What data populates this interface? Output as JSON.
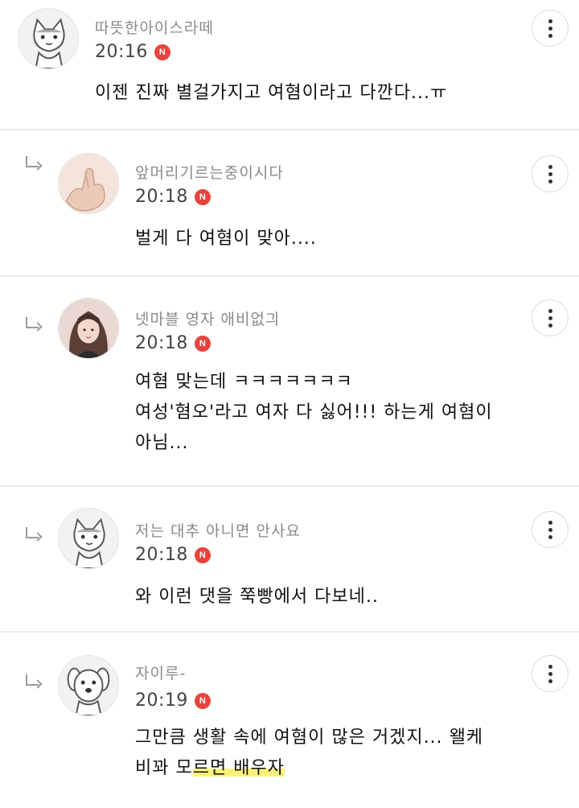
{
  "comments": [
    {
      "nickname": "따뜻한아이스라떼",
      "time": "20:16",
      "badge": "N",
      "lines": [
        "이젠 진짜 별걸가지고 여혐이라고 다깐다...ㅠ"
      ],
      "avatar": "cat-sketch-avatar",
      "is_reply": false
    },
    {
      "nickname": "앞머리기르는중이시다",
      "time": "20:18",
      "badge": "N",
      "lines": [
        "벌게 다 여혐이 맞아...."
      ],
      "avatar": "hand-photo-avatar",
      "is_reply": true
    },
    {
      "nickname": "넷마블 영자 애비없긔",
      "time": "20:18",
      "badge": "N",
      "lines": [
        "여혐 맞는데 ㅋㅋㅋㅋㅋㅋㅋ",
        "여성'혐오'라고 여자 다 싫어!!! 하는게 여혐이",
        "아님..."
      ],
      "avatar": "girl-photo-avatar",
      "is_reply": true
    },
    {
      "nickname": "저는 대추 아니면 안사요",
      "time": "20:18",
      "badge": "N",
      "lines": [
        "와 이런 댓을 쭉빵에서 다보네.."
      ],
      "avatar": "cat-sketch-avatar",
      "is_reply": true
    },
    {
      "nickname": "자이루-",
      "time": "20:19",
      "badge": "N",
      "lines": [
        "그만큼 생활 속에 여혐이 많은 거겠지... 왤케"
      ],
      "line2_plain": "비꽈 모",
      "line2_highlight": "르면 배우자",
      "avatar": "dog-sketch-avatar",
      "is_reply": true
    }
  ],
  "icons": {
    "reply": "reply-arrow-icon",
    "more": "more-vertical-icon"
  },
  "colors": {
    "badge": "#e8433d",
    "highlight": "#fbf27a"
  }
}
